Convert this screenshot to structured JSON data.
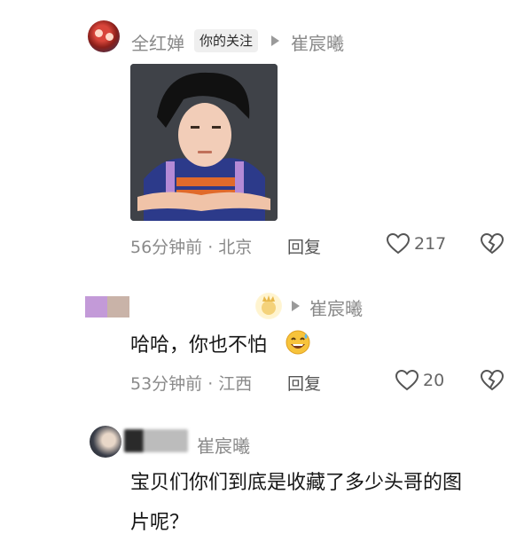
{
  "comments": [
    {
      "username": "全红婵",
      "tag": "你的关注",
      "reply_to": "崔宸曦",
      "meta": "56分钟前 · 北京",
      "reply_label": "回复",
      "likes": "217",
      "sticker": "face-sticker"
    },
    {
      "reply_to": "崔宸曦",
      "text": "哈哈，你也不怕",
      "emoji": "sweat-smile-emoji",
      "meta": "53分钟前 · 江西",
      "reply_label": "回复",
      "likes": "20"
    },
    {
      "reply_to": "崔宸曦",
      "text_line1": "宝贝们你们到底是收藏了多少头哥的图",
      "text_line2": "片呢？"
    }
  ],
  "icons": [
    "heart-icon",
    "dislike-icon",
    "arrow-icon"
  ],
  "colors": {
    "secondary_text": "#8a8a8a",
    "primary_text": "#161616",
    "tag_bg": "#efefef"
  }
}
